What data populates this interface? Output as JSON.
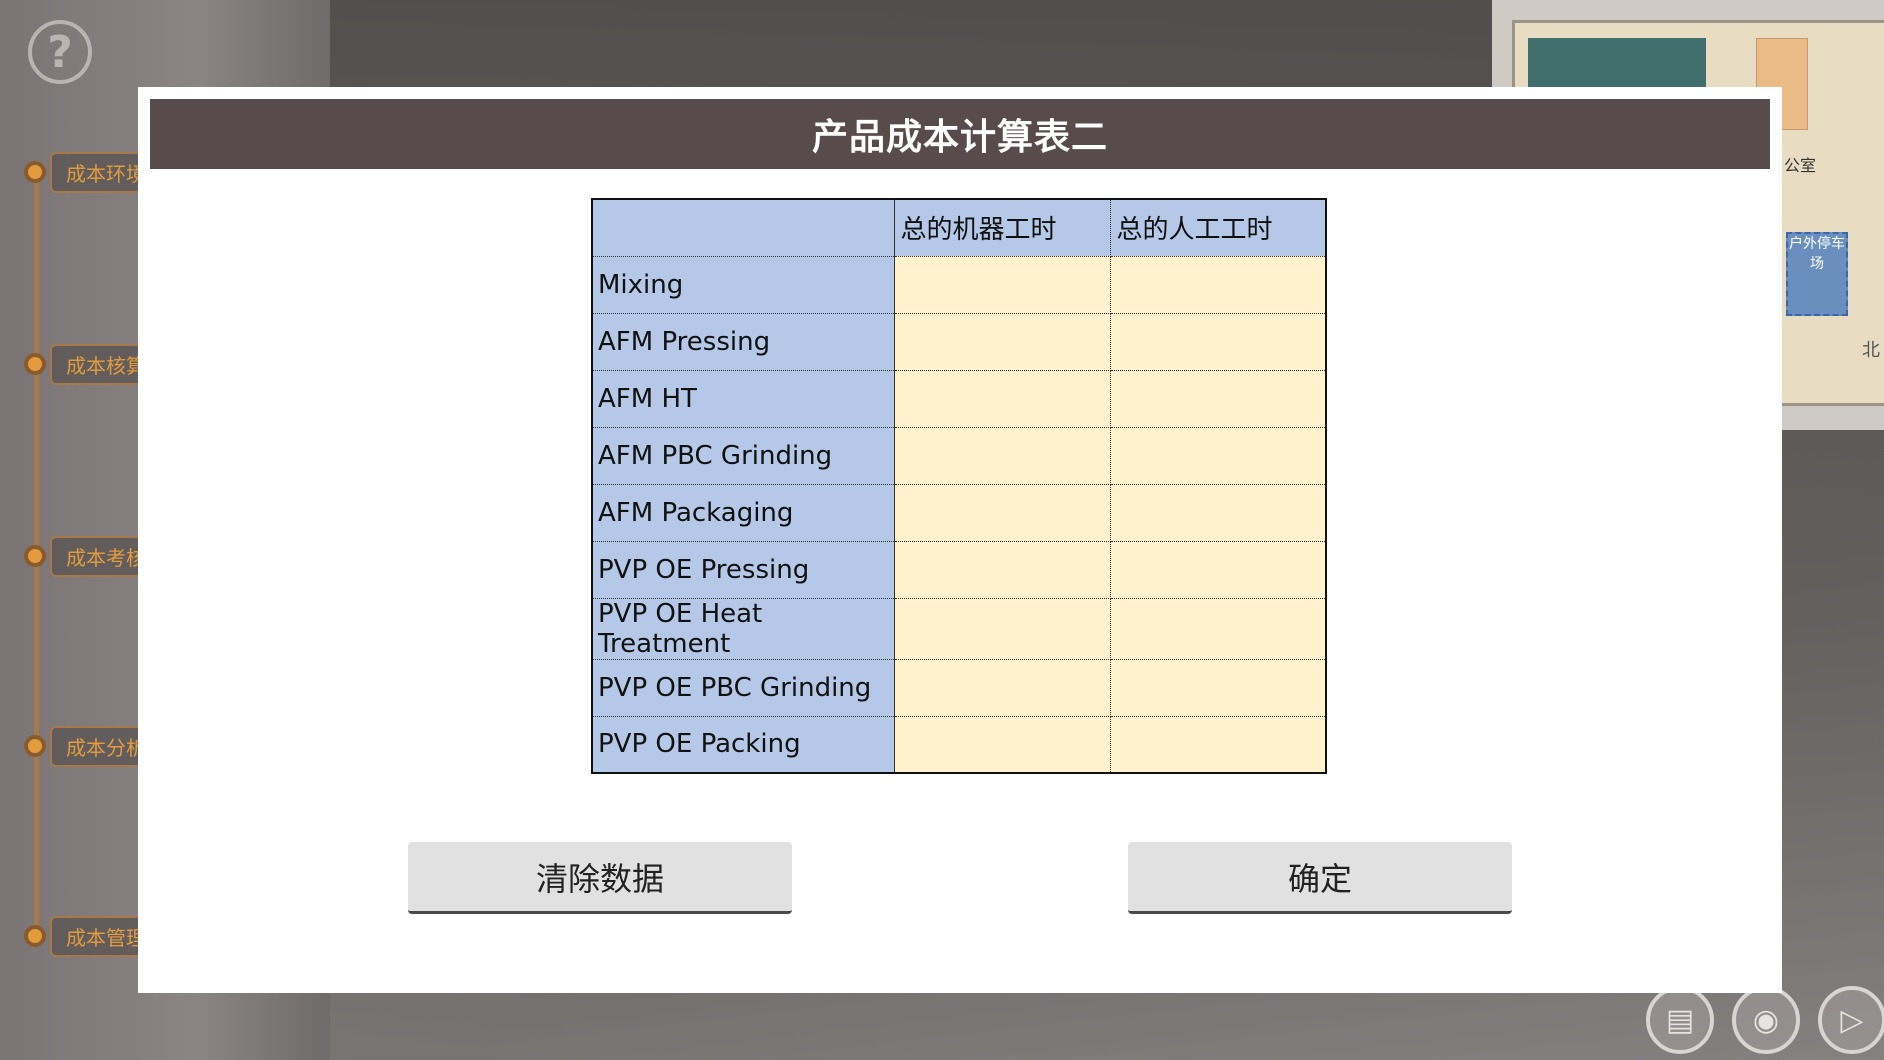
{
  "help": {
    "icon": "question-mark-icon",
    "label": "?"
  },
  "timeline": [
    {
      "label": "成本环境"
    },
    {
      "label": "成本核算"
    },
    {
      "label": "成本考核"
    },
    {
      "label": "成本分析"
    },
    {
      "label": "成本管理报告"
    }
  ],
  "minimap": {
    "office_label": "公室",
    "parking_label": "户外停车场",
    "north_label": "北"
  },
  "dialog": {
    "title": "产品成本计算表二",
    "table": {
      "headers": [
        "",
        "总的机器工时",
        "总的人工工时"
      ],
      "rows": [
        {
          "label": "Mixing",
          "machine_hours": "",
          "labor_hours": ""
        },
        {
          "label": "AFM Pressing",
          "machine_hours": "",
          "labor_hours": ""
        },
        {
          "label": "AFM HT",
          "machine_hours": "",
          "labor_hours": ""
        },
        {
          "label": "AFM PBC Grinding",
          "machine_hours": "",
          "labor_hours": ""
        },
        {
          "label": "AFM Packaging",
          "machine_hours": "",
          "labor_hours": ""
        },
        {
          "label": "PVP OE Pressing",
          "machine_hours": "",
          "labor_hours": ""
        },
        {
          "label": "PVP OE Heat Treatment",
          "machine_hours": "",
          "labor_hours": ""
        },
        {
          "label": "PVP OE PBC Grinding",
          "machine_hours": "",
          "labor_hours": ""
        },
        {
          "label": "PVP OE Packing",
          "machine_hours": "",
          "labor_hours": ""
        }
      ],
      "colors": {
        "header_bg": "#b5c8e8",
        "input_bg": "#fff2cc"
      }
    },
    "buttons": {
      "clear": "清除数据",
      "confirm": "确定"
    }
  },
  "bottom_icons": [
    "book-icon",
    "bag-icon",
    "speaker-mute-icon"
  ],
  "colors": {
    "header_bar": "#584b4b",
    "accent_orange": "#e29b3d"
  }
}
